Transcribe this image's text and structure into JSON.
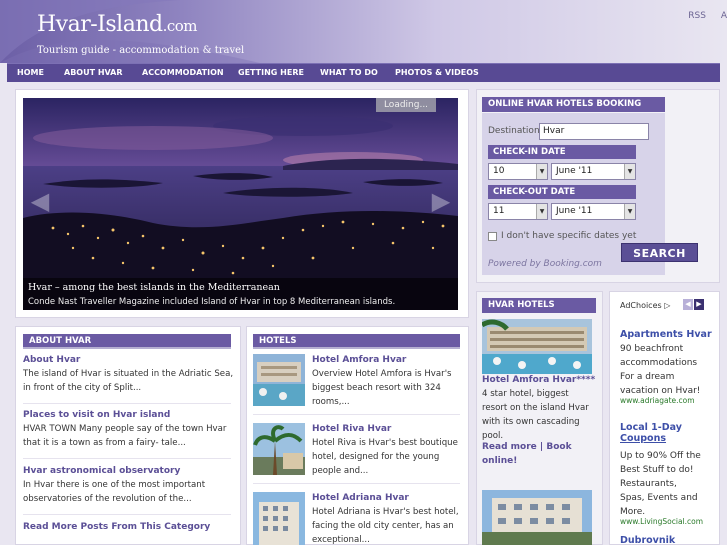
{
  "header": {
    "logo_main": "Hvar-Island",
    "logo_suffix": ".com",
    "tagline": "Tourism guide - accommodation & travel",
    "toplinks": [
      "RSS",
      "A"
    ]
  },
  "nav": [
    "HOME",
    "ABOUT HVAR",
    "ACCOMMODATION",
    "GETTING HERE",
    "WHAT TO DO",
    "PHOTOS & VIDEOS"
  ],
  "slideshow": {
    "loading": "Loading...",
    "title": "Hvar – among the best islands in the Mediterranean",
    "description": "Conde Nast Traveller Magazine included Island of Hvar in top 8 Mediterranean islands."
  },
  "booking": {
    "title": "ONLINE HVAR HOTELS BOOKING",
    "destination_label": "Destination",
    "destination_value": "Hvar",
    "checkin_label": "CHECK-IN DATE",
    "checkin_day": "10",
    "checkin_month": "June '11",
    "checkout_label": "CHECK-OUT DATE",
    "checkout_day": "11",
    "checkout_month": "June '11",
    "no_dates_label": "I don't have specific dates yet",
    "search_label": "SEARCH",
    "powered": "Powered by Booking.com"
  },
  "about": {
    "title": "ABOUT HVAR",
    "items": [
      {
        "title": "About Hvar",
        "lines": [
          "The island of Hvar is situated in the Adriatic Sea,",
          "in front of the city of Split..."
        ]
      },
      {
        "title": "Places to visit on Hvar island",
        "lines": [
          "HVAR TOWN Many people say of the town Hvar",
          "that it is a town as from a fairy- tale..."
        ]
      },
      {
        "title": "Hvar astronomical observatory",
        "lines": [
          "In Hvar there is one of the most important",
          "observatories of the revolution of the..."
        ]
      }
    ],
    "more": "Read More Posts From This Category"
  },
  "hotels": {
    "title": "HOTELS",
    "items": [
      {
        "title": "Hotel Amfora Hvar",
        "lines": [
          "Overview Hotel Amfora is Hvar's",
          "biggest beach resort with 324",
          "rooms,..."
        ]
      },
      {
        "title": "Hotel Riva Hvar",
        "lines": [
          "Hotel Riva is Hvar's best boutique",
          "hotel, designed for the young",
          "people and..."
        ]
      },
      {
        "title": "Hotel Adriana Hvar",
        "lines": [
          "Hotel Adriana is Hvar's best hotel,",
          "facing the old city center, has an",
          "exceptional..."
        ]
      }
    ]
  },
  "hvar_hotels": {
    "title": "HVAR HOTELS",
    "featured_title": "Hotel Amfora Hvar****",
    "featured_lines": [
      "4 star hotel, biggest",
      "resort on the island Hvar",
      "with its own cascading",
      "pool."
    ],
    "book_link_1": "Read more | Book",
    "book_link_2": "online!"
  },
  "ads": {
    "adchoices": "AdChoices",
    "items": [
      {
        "title": "Apartments Hvar",
        "lines": [
          "90 beachfront",
          "accommodations",
          "For a dream",
          "vacation on Hvar!"
        ],
        "url": "www.adriagate.com"
      },
      {
        "title_lines": [
          "Local 1-Day",
          "Coupons"
        ],
        "lines": [
          "Up to 90% Off the",
          "Best Stuff to do!",
          "Restaurants,",
          "Spas, Events and",
          "More."
        ],
        "url": "www.LivingSocial.com"
      },
      {
        "title": "Dubrovnik"
      }
    ]
  }
}
